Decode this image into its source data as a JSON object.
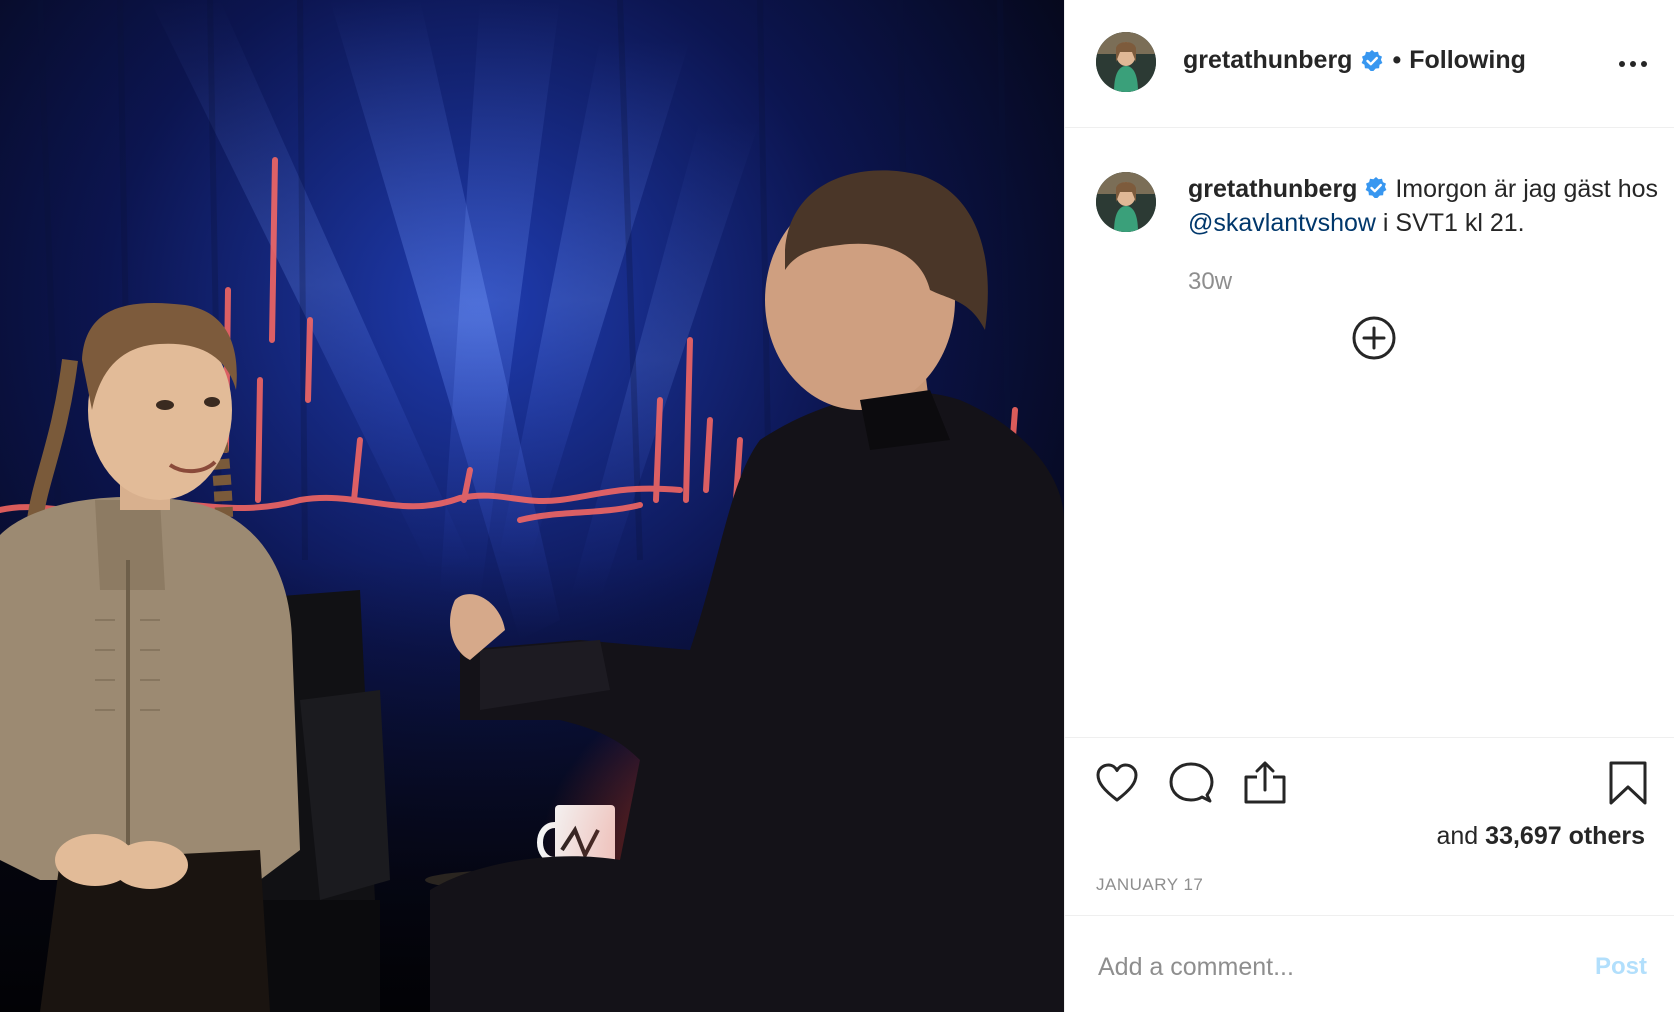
{
  "post": {
    "username": "gretathunberg",
    "separator": "•",
    "follow_status": "Following",
    "more_icon": "more-horizontal-icon",
    "verified_color": "#3897f0"
  },
  "caption": {
    "username": "gretathunberg",
    "text_before": "Imorgon är jag gäst hos ",
    "mention": "@skavlantvshow",
    "text_after": " i SVT1 kl 21.",
    "time": "30w",
    "load_more_icon": "plus-circle-icon"
  },
  "actions": {
    "like_icon": "heart-icon",
    "comment_icon": "comment-icon",
    "share_icon": "share-icon",
    "save_icon": "bookmark-icon"
  },
  "likes": {
    "prefix": "and",
    "count": "33,697 others"
  },
  "date": "JANUARY 17",
  "comment": {
    "placeholder": "Add a comment...",
    "post_label": "Post"
  },
  "colors": {
    "mention": "#00376b",
    "muted": "#8e8e8e",
    "post_button": "#b2dffc"
  }
}
